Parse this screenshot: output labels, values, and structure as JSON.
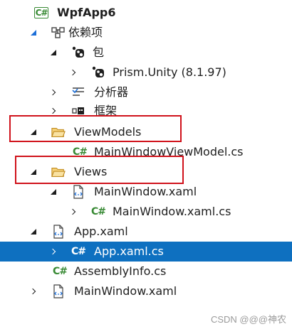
{
  "colors": {
    "selection": "#0e70c0",
    "csharp": "#388a34",
    "folder": "#d7a22a",
    "highlight_box": "#d0121b"
  },
  "tree": {
    "project": {
      "label": "WpfApp6",
      "icon": "csharp-project-icon"
    },
    "dependencies": {
      "label": "依赖项",
      "icon": "dependencies-icon"
    },
    "packages": {
      "label": "包",
      "icon": "nuget-icon"
    },
    "prism_unity": {
      "label": "Prism.Unity (8.1.97)",
      "icon": "nuget-icon"
    },
    "analyzers": {
      "label": "分析器",
      "icon": "analyzer-icon"
    },
    "frameworks": {
      "label": "框架",
      "icon": "framework-icon"
    },
    "viewmodels_folder": {
      "label": "ViewModels",
      "icon": "folder-icon"
    },
    "mainwindowviewmodel": {
      "label": "MainWindowViewModel.cs",
      "icon": "csharp-file-icon"
    },
    "views_folder": {
      "label": "Views",
      "icon": "folder-icon"
    },
    "mainwindow_xaml_views": {
      "label": "MainWindow.xaml",
      "icon": "xaml-file-icon"
    },
    "mainwindow_xaml_cs_views": {
      "label": "MainWindow.xaml.cs",
      "icon": "csharp-file-icon"
    },
    "app_xaml": {
      "label": "App.xaml",
      "icon": "xaml-file-icon"
    },
    "app_xaml_cs": {
      "label": "App.xaml.cs",
      "icon": "csharp-file-icon",
      "selected": true
    },
    "assemblyinfo": {
      "label": "AssemblyInfo.cs",
      "icon": "csharp-file-icon"
    },
    "mainwindow_xaml_root": {
      "label": "MainWindow.xaml",
      "icon": "xaml-file-icon"
    }
  },
  "watermark": "CSDN @@@神农"
}
